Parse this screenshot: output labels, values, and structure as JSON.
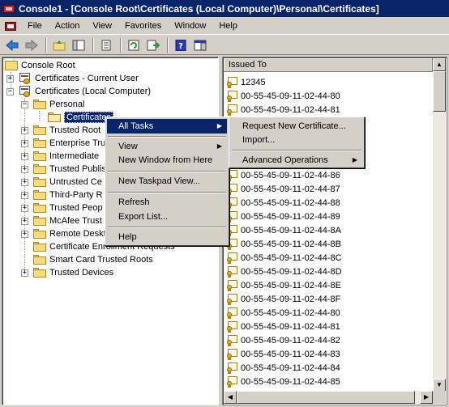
{
  "window": {
    "title": "Console1 - [Console Root\\Certificates (Local Computer)\\Personal\\Certificates]"
  },
  "menubar": {
    "items": [
      "File",
      "Action",
      "View",
      "Favorites",
      "Window",
      "Help"
    ]
  },
  "toolbar": {
    "buttons": [
      "back-icon",
      "forward-icon",
      "up-folder-icon",
      "show-hide-tree-icon",
      "properties-icon",
      "refresh-icon",
      "export-list-icon",
      "help-icon",
      "show-hide-action-pane-icon"
    ]
  },
  "tree": {
    "root": "Console Root",
    "current_user": "Certificates - Current User",
    "local_computer": "Certificates (Local Computer)",
    "personal": "Personal",
    "certificates": "Certificates",
    "stores": [
      "Trusted Root",
      "Enterprise Tru",
      "Intermediate",
      "Trusted Publis",
      "Untrusted Ce",
      "Third-Party R",
      "Trusted Peop",
      "McAfee Trust",
      "Remote Deskt",
      "Certificate Enrollment Requests",
      "Smart Card Trusted Roots",
      "Trusted Devices"
    ]
  },
  "list": {
    "column": "Issued To",
    "rows": [
      "12345",
      "00-55-45-09-11-02-44-80",
      "00-55-45-09-11-02-44-81",
      "00-55-45-09-11-02-44-86",
      "00-55-45-09-11-02-44-87",
      "00-55-45-09-11-02-44-88",
      "00-55-45-09-11-02-44-89",
      "00-55-45-09-11-02-44-8A",
      "00-55-45-09-11-02-44-8B",
      "00-55-45-09-11-02-44-8C",
      "00-55-45-09-11-02-44-8D",
      "00-55-45-09-11-02-44-8E",
      "00-55-45-09-11-02-44-8F",
      "00-55-45-09-11-02-44-80",
      "00-55-45-09-11-02-44-81",
      "00-55-45-09-11-02-44-82",
      "00-55-45-09-11-02-44-83",
      "00-55-45-09-11-02-44-84",
      "00-55-45-09-11-02-44-85"
    ]
  },
  "context_menu": {
    "all_tasks": "All Tasks",
    "view": "View",
    "new_window": "New Window from Here",
    "new_taskpad": "New Taskpad View...",
    "refresh": "Refresh",
    "export_list": "Export List...",
    "help": "Help"
  },
  "submenu": {
    "request_new": "Request New Certificate...",
    "import": "Import...",
    "advanced": "Advanced Operations"
  },
  "colors": {
    "highlight": "#0a246a",
    "titlebar": "#0a246a",
    "face": "#d4d0c8"
  }
}
